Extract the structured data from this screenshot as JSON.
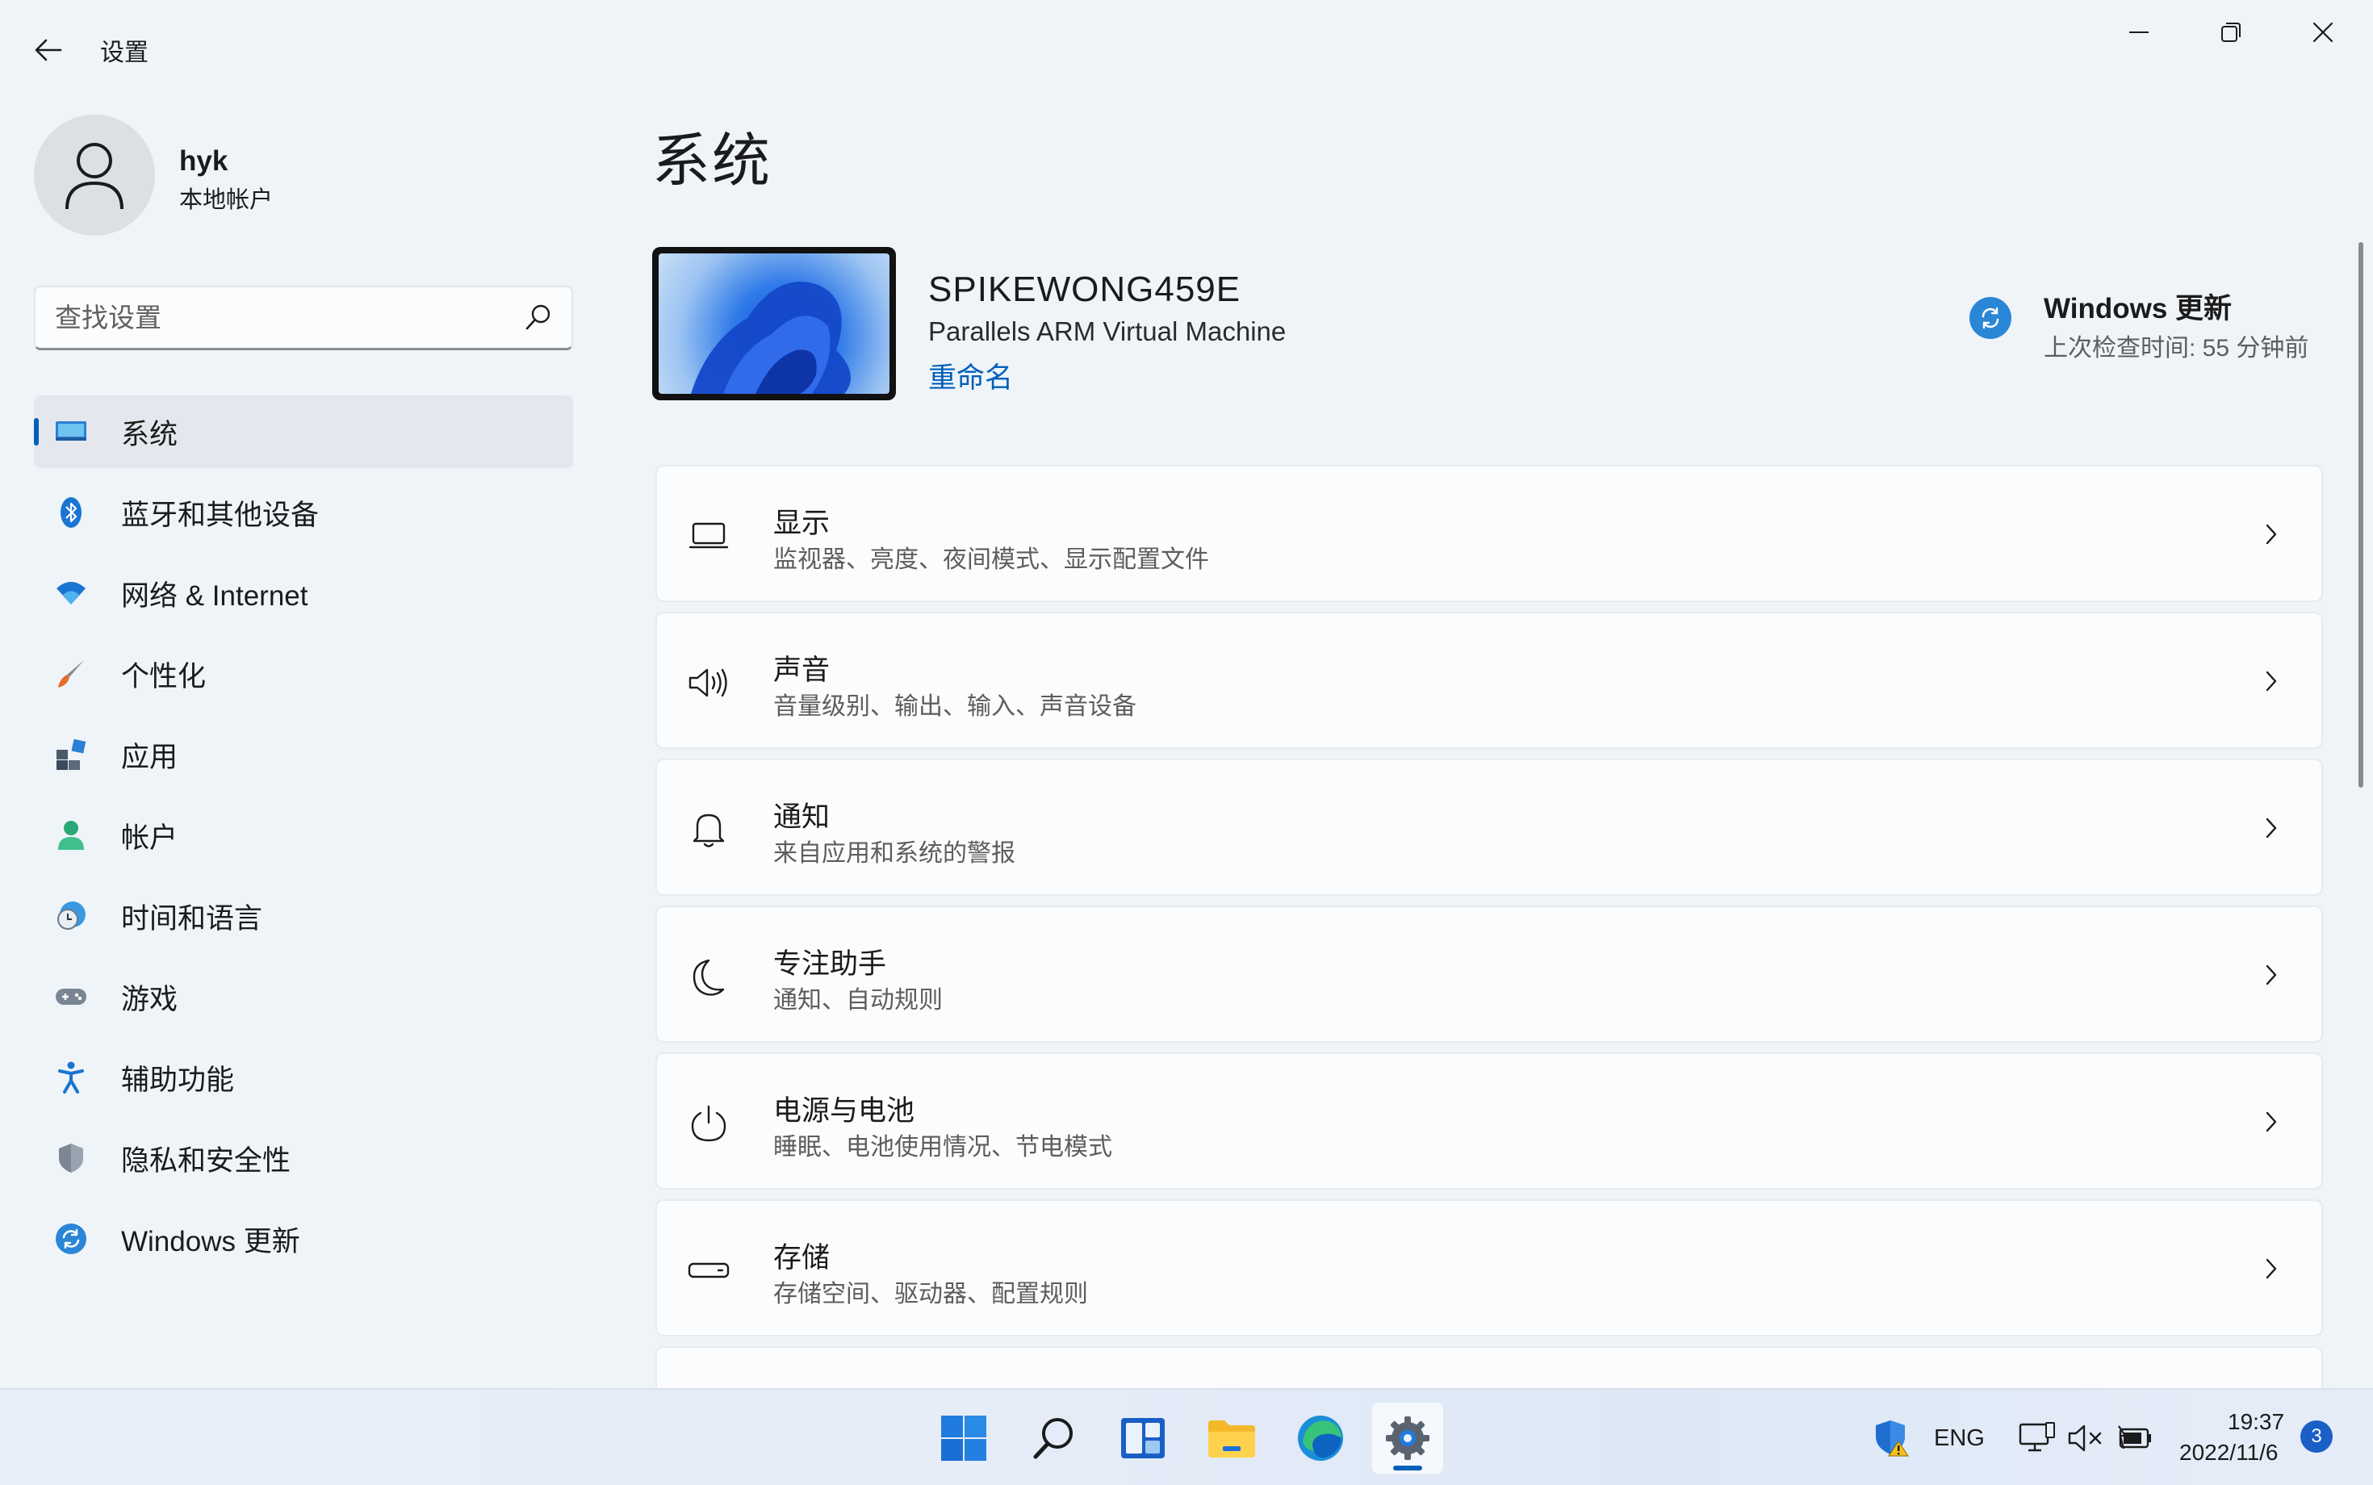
{
  "window": {
    "title": "设置"
  },
  "user": {
    "name": "hyk",
    "account_type": "本地帐户"
  },
  "search": {
    "placeholder": "查找设置"
  },
  "sidebar": {
    "items": [
      {
        "label": "系统",
        "icon": "system-monitor-icon",
        "active": true
      },
      {
        "label": "蓝牙和其他设备",
        "icon": "bluetooth-icon"
      },
      {
        "label": "网络 & Internet",
        "icon": "wifi-icon"
      },
      {
        "label": "个性化",
        "icon": "paintbrush-icon"
      },
      {
        "label": "应用",
        "icon": "apps-icon"
      },
      {
        "label": "帐户",
        "icon": "account-icon"
      },
      {
        "label": "时间和语言",
        "icon": "clock-globe-icon"
      },
      {
        "label": "游戏",
        "icon": "gamepad-icon"
      },
      {
        "label": "辅助功能",
        "icon": "accessibility-icon"
      },
      {
        "label": "隐私和安全性",
        "icon": "shield-icon"
      },
      {
        "label": "Windows 更新",
        "icon": "windows-update-icon"
      }
    ]
  },
  "main": {
    "page_title": "系统",
    "device": {
      "name": "SPIKEWONG459E",
      "model": "Parallels ARM Virtual Machine",
      "rename_label": "重命名"
    },
    "windows_update": {
      "title": "Windows 更新",
      "subtitle": "上次检查时间: 55 分钟前"
    },
    "cards": [
      {
        "title": "显示",
        "subtitle": "监视器、亮度、夜间模式、显示配置文件",
        "icon": "display-icon"
      },
      {
        "title": "声音",
        "subtitle": "音量级别、输出、输入、声音设备",
        "icon": "speaker-icon"
      },
      {
        "title": "通知",
        "subtitle": "来自应用和系统的警报",
        "icon": "bell-icon"
      },
      {
        "title": "专注助手",
        "subtitle": "通知、自动规则",
        "icon": "moon-icon"
      },
      {
        "title": "电源与电池",
        "subtitle": "睡眠、电池使用情况、节电模式",
        "icon": "power-icon"
      },
      {
        "title": "存储",
        "subtitle": "存储空间、驱动器、配置规则",
        "icon": "storage-icon"
      }
    ]
  },
  "taskbar": {
    "apps": [
      {
        "name": "start",
        "icon": "windows-start-icon"
      },
      {
        "name": "search",
        "icon": "search-icon"
      },
      {
        "name": "widgets",
        "icon": "widgets-icon"
      },
      {
        "name": "file-explorer",
        "icon": "folder-icon"
      },
      {
        "name": "edge",
        "icon": "edge-icon"
      },
      {
        "name": "settings",
        "icon": "settings-gear-icon",
        "active": true
      }
    ],
    "tray": {
      "language": "ENG",
      "time": "19:37",
      "date": "2022/11/6",
      "notification_count": "3"
    }
  },
  "colors": {
    "accent": "#005fb8",
    "background": "#eff4f9",
    "card": "#fbfcfd"
  }
}
